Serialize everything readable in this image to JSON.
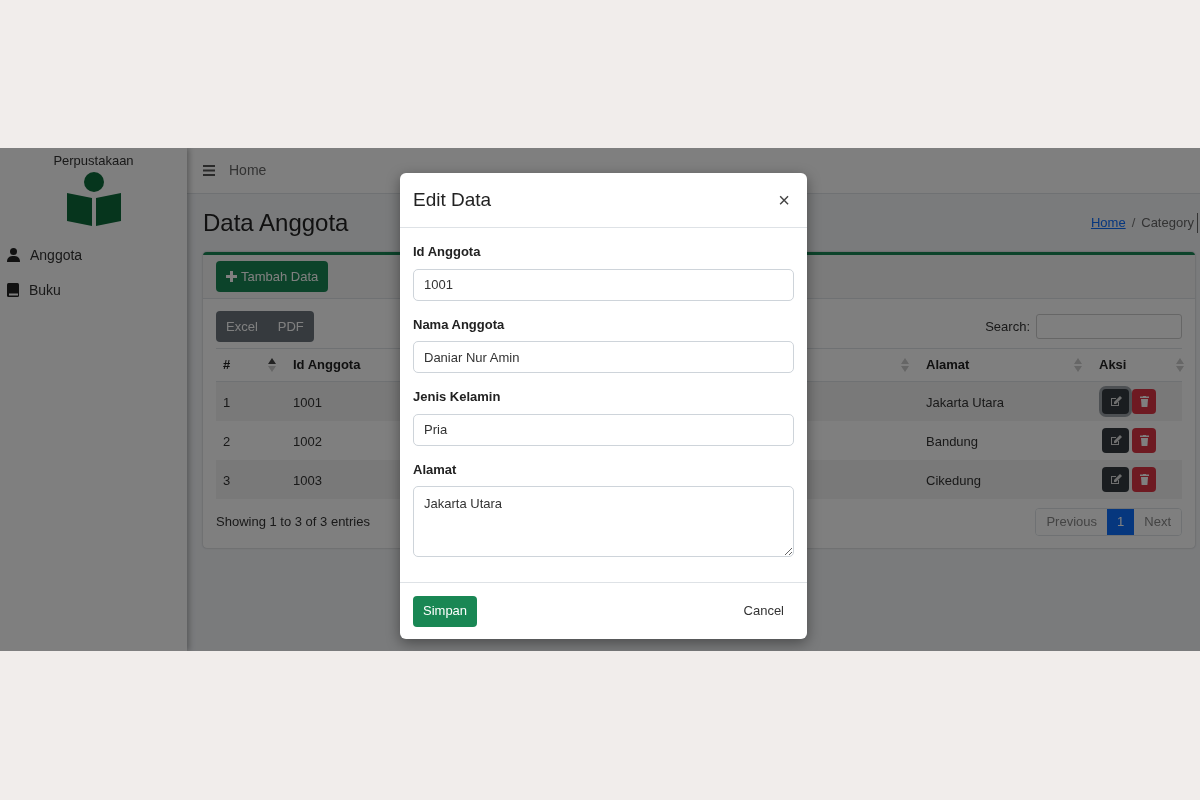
{
  "sidebar": {
    "brand": "Perpustakaan",
    "items": [
      {
        "label": "Anggota",
        "kind": "user"
      },
      {
        "label": "Buku",
        "kind": "book"
      }
    ]
  },
  "navbar": {
    "home": "Home"
  },
  "page": {
    "title": "Data Anggota",
    "breadcrumb": [
      "Home",
      "Category"
    ],
    "breadcrumb_separator": "/"
  },
  "card": {
    "add_button": "Tambah Data",
    "export_buttons": [
      "Excel",
      "PDF"
    ],
    "search_label": "Search:",
    "table": {
      "columns": [
        {
          "label": "#",
          "sorted": true
        },
        {
          "label": "Id Anggota"
        },
        {
          "sorted": false
        },
        {
          "label": "Alamat",
          "sorted": false
        },
        {
          "label": "Aksi",
          "sorted": false
        }
      ],
      "rows": [
        {
          "cells": [
            "1",
            "1001",
            "Jakarta Utara"
          ],
          "edit_focused": true
        },
        {
          "cells": [
            "2",
            "1002",
            "Bandung"
          ],
          "edit_focused": false
        },
        {
          "cells": [
            "3",
            "1003",
            "Cikedung"
          ],
          "edit_focused": false
        }
      ]
    },
    "info": "Showing 1 to 3 of 3 entries",
    "pagination": [
      {
        "label": "Previous",
        "selected": false
      },
      {
        "label": "1",
        "selected": true
      },
      {
        "label": "Next",
        "selected": false
      }
    ]
  },
  "modal": {
    "title": "Edit Data",
    "close": "×",
    "fields": [
      {
        "label": "Id Anggota",
        "value": "1001",
        "kind": "input"
      },
      {
        "label": "Nama Anggota",
        "value": "Daniar Nur Amin",
        "kind": "input"
      },
      {
        "label": "Jenis Kelamin",
        "value": "Pria",
        "kind": "input"
      },
      {
        "label": "Alamat",
        "value": "Jakarta Utara",
        "kind": "textarea"
      }
    ],
    "save": "Simpan",
    "cancel": "Cancel"
  }
}
